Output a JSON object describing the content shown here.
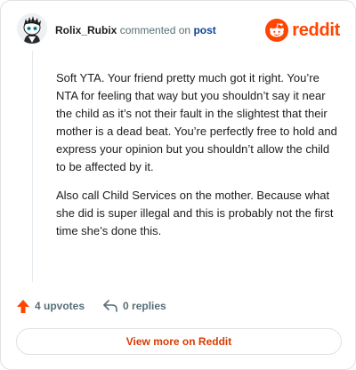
{
  "header": {
    "author": "Rolix_Rubix",
    "action_text": "commented on",
    "post_link": "post",
    "brand_name": "reddit"
  },
  "comment": {
    "paragraphs": [
      "Soft YTA. Your friend pretty much got it right. You’re NTA for feeling that way but you shouldn’t say it near the child as it’s not their fault in the slightest that their mother is a dead beat. You’re perfectly free to hold and express your opinion but you shouldn’t allow the child to be affected by it.",
      "Also call Child Services on the mother. Because what she did is super illegal and this is probably not the first time she’s done this."
    ]
  },
  "actions": {
    "upvotes_label": "4 upvotes",
    "replies_label": "0 replies"
  },
  "footer": {
    "view_more_label": "View more on Reddit"
  },
  "colors": {
    "brand": "#ff4500",
    "upvote_icon": "#ff4500",
    "link": "#0a449b",
    "view_more_text": "#d93a00",
    "muted_text": "#576f76"
  },
  "icons": {
    "avatar": "snoo-avatar-icon",
    "brand": "reddit-logo-icon",
    "upvote": "upvote-arrow-icon",
    "reply": "reply-arrow-icon"
  }
}
